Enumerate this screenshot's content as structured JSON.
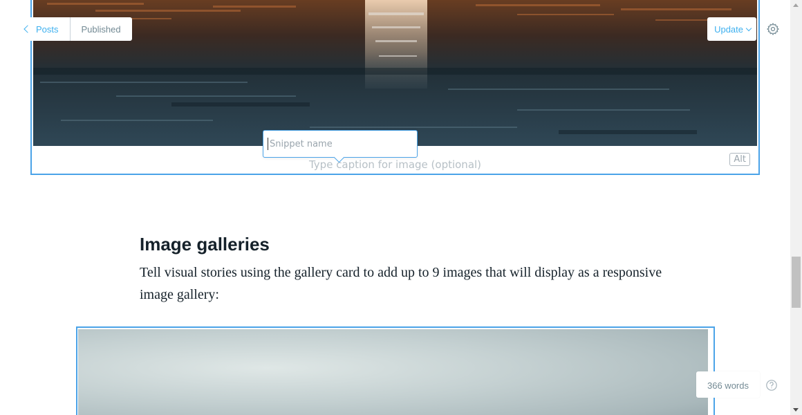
{
  "header": {
    "back_label": "Posts",
    "status_label": "Published",
    "update_label": "Update"
  },
  "image_card": {
    "caption_placeholder": "Type caption for image (optional)",
    "alt_label": "Alt"
  },
  "snippet": {
    "placeholder": "Snippet name"
  },
  "content": {
    "heading": "Image galleries",
    "paragraph": "Tell visual stories using the gallery card to add up to 9 images that will display as a responsive image gallery:"
  },
  "footer": {
    "word_count": "366 words"
  },
  "icons": {
    "back": "chevron-left-icon",
    "update": "chevron-down-icon",
    "settings": "gear-icon",
    "help": "question-circle-icon"
  },
  "colors": {
    "accent": "#3eb0ef",
    "card_border": "#4aa3e8",
    "muted_text": "#738a94",
    "heading_text": "#15212a"
  }
}
